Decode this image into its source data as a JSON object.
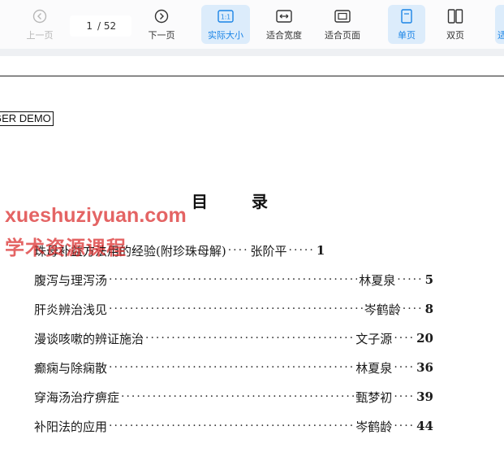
{
  "toolbar": {
    "prev_label": "上一页",
    "next_label": "下一页",
    "page_current": "1",
    "page_total": "/ 52",
    "actual_size_label": "实际大小",
    "fit_width_label": "适合宽度",
    "fit_page_label": "适合页面",
    "single_page_label": "单页",
    "double_page_label": "双页",
    "actual_size_icon_text": "1:1",
    "cut_label": "适"
  },
  "document": {
    "demo_stamp": "GER DEMO",
    "title": "目录",
    "watermark_line1": "xueshuziyuan.com",
    "watermark_line2": "学术资源课程",
    "toc": [
      {
        "title": "珠母补益方法用的经验(附珍珠母解)",
        "author": "张阶平",
        "page": "1"
      },
      {
        "title": "腹泻与理泻汤",
        "author": "林夏泉",
        "page": "5"
      },
      {
        "title": "肝炎辨治浅见",
        "author": "岑鹤龄",
        "page": "8"
      },
      {
        "title": "漫谈咳嗽的辨证施治",
        "author": "文子源",
        "page": "20"
      },
      {
        "title": "癫痫与除痫散",
        "author": "林夏泉",
        "page": "36"
      },
      {
        "title": "穿海汤治疗痹症",
        "author": "甄梦初",
        "page": "39"
      },
      {
        "title": "补阳法的应用",
        "author": "岑鹤龄",
        "page": "44"
      }
    ]
  },
  "colors": {
    "accent": "#1a84e6",
    "active_bg": "#dcecfb",
    "watermark": "#d82828"
  }
}
